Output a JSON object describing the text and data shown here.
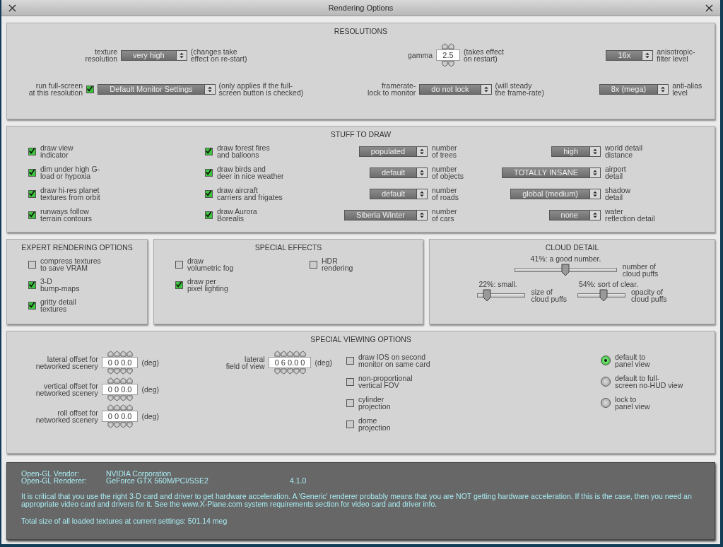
{
  "window": {
    "title": "Rendering Options"
  },
  "resolutions": {
    "title": "RESOLUTIONS",
    "rows": [
      [
        {
          "kind": "dropdown",
          "label": "texture\nresolution",
          "value": "very high",
          "note": "(changes take\neffect on re-start)"
        },
        {
          "kind": "spinner",
          "label": "gamma",
          "value": "2.5",
          "note": "(takes effect\non restart)"
        },
        {
          "kind": "dropdown",
          "value": "16x",
          "note": "anisotropic-\nfilter level"
        }
      ],
      [
        {
          "kind": "check-dropdown",
          "label": "run full-screen\nat this resolution",
          "checked": true,
          "value": "Default Monitor Settings",
          "note": "(only applies if the full-\nscreen button is checked)"
        },
        {
          "kind": "dropdown",
          "label": "framerate-\nlock to monitor",
          "value": "do not lock",
          "note": "(will steady\nthe frame-rate)"
        },
        {
          "kind": "dropdown",
          "value": "8x (mega)",
          "note": "anti-alias\nlevel"
        }
      ]
    ]
  },
  "stuff": {
    "title": "STUFF TO DRAW",
    "rows": [
      {
        "checks": [
          {
            "label": "draw view\nindicator",
            "checked": true
          },
          {
            "label": "draw forest fires\nand balloons",
            "checked": true
          }
        ],
        "selects": [
          {
            "value": "populated",
            "note": "number\nof trees"
          },
          {
            "value": "high",
            "note": "world detail\ndistance"
          }
        ]
      },
      {
        "checks": [
          {
            "label": "dim under high G-\nload or hypoxia",
            "checked": true
          },
          {
            "label": "draw birds and\ndeer in nice weather",
            "checked": true
          }
        ],
        "selects": [
          {
            "value": "default",
            "note": "number\nof objects"
          },
          {
            "value": "TOTALLY INSANE",
            "note": "airport\ndetail"
          }
        ]
      },
      {
        "checks": [
          {
            "label": "draw hi-res planet\ntextures from orbit",
            "checked": true
          },
          {
            "label": "draw aircraft\ncarriers and frigates",
            "checked": true
          }
        ],
        "selects": [
          {
            "value": "default",
            "note": "number\nof roads"
          },
          {
            "value": "global (medium)",
            "note": "shadow\ndetail"
          }
        ]
      },
      {
        "checks": [
          {
            "label": "runways follow\nterrain contours",
            "checked": true
          },
          {
            "label": "draw Aurora\nBorealis",
            "checked": true
          }
        ],
        "selects": [
          {
            "value": "Siberia Winter",
            "note": "number\nof cars"
          },
          {
            "value": "none",
            "note": "water\nreflection detail"
          }
        ]
      }
    ]
  },
  "expert": {
    "title": "EXPERT RENDERING OPTIONS",
    "checks": [
      {
        "label": "compress textures\nto save VRAM",
        "checked": false
      },
      {
        "label": "3-D\nbump-maps",
        "checked": true
      },
      {
        "label": "gritty detail\ntextures",
        "checked": true
      }
    ]
  },
  "effects": {
    "title": "SPECIAL EFFECTS",
    "columns": [
      [
        {
          "label": "draw\nvolumetric fog",
          "checked": false
        },
        {
          "label": "draw per\npixel lighting",
          "checked": true
        }
      ],
      [
        {
          "label": "HDR\nrendering",
          "checked": false
        }
      ]
    ]
  },
  "cloud": {
    "title": "CLOUD DETAIL",
    "sliders": [
      {
        "caption": "41%: a good number.",
        "level": 0.5,
        "label": "number of\ncloud puffs"
      },
      {
        "caption": "22%: small.",
        "level": 0.2,
        "label": "size of\ncloud puffs"
      },
      {
        "caption": "54%: sort of clear.",
        "level": 0.54,
        "label": "opacity of\ncloud puffs"
      }
    ]
  },
  "viewing": {
    "title": "SPECIAL VIEWING OPTIONS",
    "offsets": [
      {
        "label": "lateral offset for\nnetworked scenery",
        "value": "0 0 0.0",
        "unit": "(deg)"
      },
      {
        "label": "vertical offset for\nnetworked scenery",
        "value": "0 0 0.0",
        "unit": "(deg)"
      },
      {
        "label": "roll offset for\nnetworked scenery",
        "value": "0 0 0.0",
        "unit": "(deg)"
      }
    ],
    "fov": [
      {
        "label": "lateral\nfield of view",
        "value": "0 6 0.0 0",
        "unit": "(deg)"
      }
    ],
    "checks": [
      {
        "label": "draw IOS on second\nmonitor on same card",
        "checked": false
      },
      {
        "label": "non-proportional\nvertical FOV",
        "checked": false
      },
      {
        "label": "cylinder\nprojection",
        "checked": false
      },
      {
        "label": "dome\nprojection",
        "checked": false
      }
    ],
    "radios": [
      {
        "label": "default to\npanel view",
        "selected": true
      },
      {
        "label": "default to full-\nscreen no-HUD view",
        "selected": false
      },
      {
        "label": "lock to\npanel view",
        "selected": false
      }
    ]
  },
  "info": {
    "rows": [
      {
        "label": "Open-GL Vendor:",
        "value": "NVIDIA Corporation"
      },
      {
        "label": "Open-GL Renderer:",
        "value": "GeForce GTX 560M/PCI/SSE2",
        "version": "4.1.0"
      }
    ],
    "message": "It is critical that you use the right 3-D card and driver to get hardware acceleration. A 'Generic' renderer probably means that you are NOT getting hardware acceleration. If this is the case, then you need an appropriate video card and drivers for it. See the www.X-Plane.com system requirements section for video card and driver info.",
    "total": "Total size of all loaded textures at current settings: 501.14 meg"
  }
}
